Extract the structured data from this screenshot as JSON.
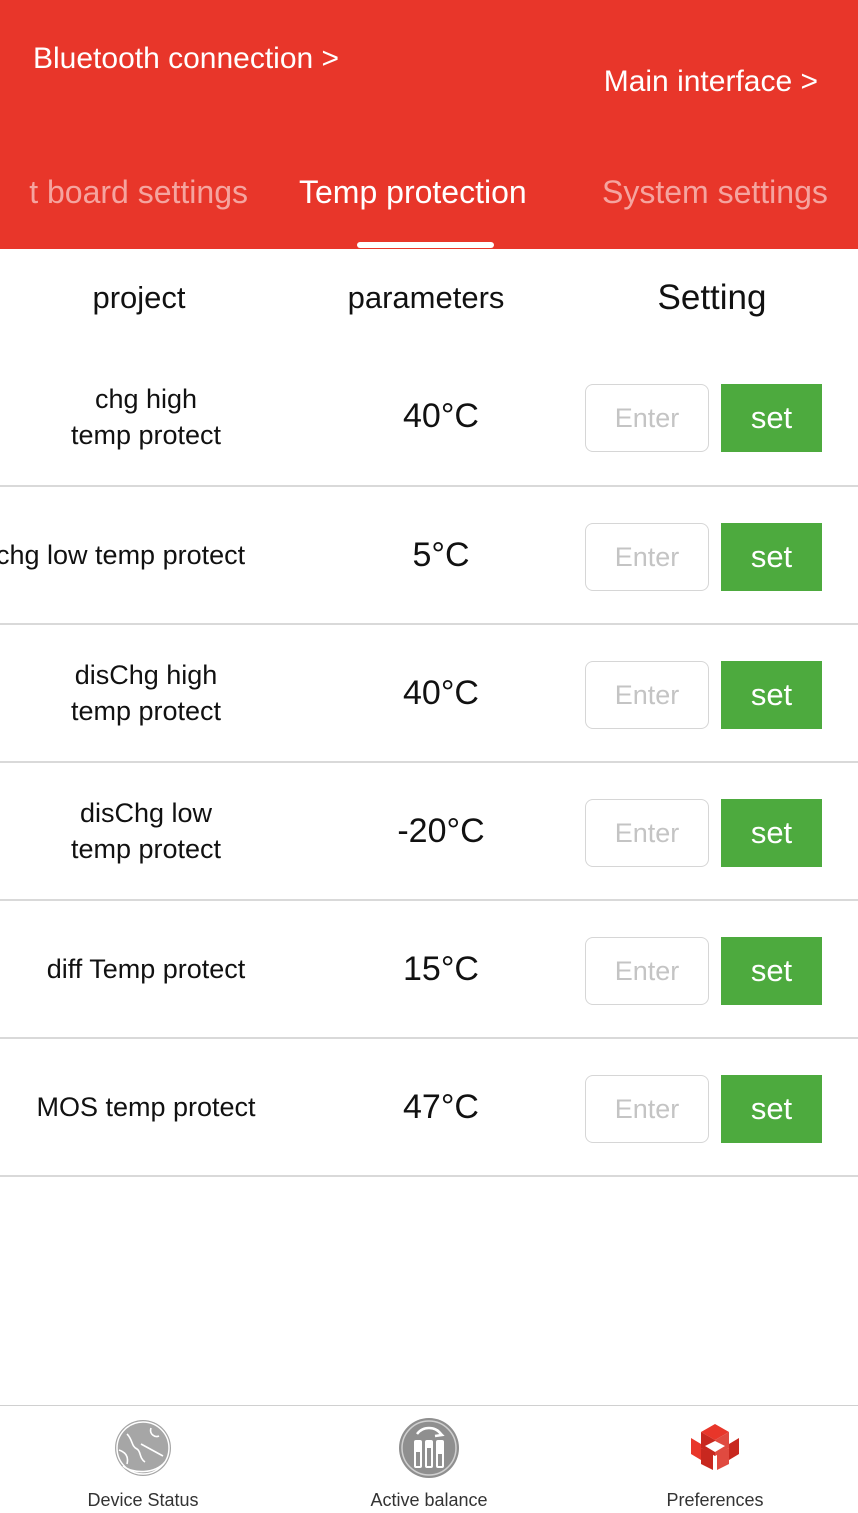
{
  "header": {
    "bluetooth_link": "Bluetooth connection >",
    "main_link": "Main interface >",
    "background_color": "#e8362a"
  },
  "tabs": [
    {
      "label": "t board settings",
      "active": false
    },
    {
      "label": "Temp protection",
      "active": true
    },
    {
      "label": "System settings",
      "active": false
    }
  ],
  "table": {
    "headers": {
      "project": "project",
      "parameters": "parameters",
      "setting": "Setting"
    },
    "rows": [
      {
        "name": "chg high\ntemp protect",
        "value": "40°C",
        "placeholder": "Enter",
        "button": "set"
      },
      {
        "name": "chg low temp protect",
        "value": "5°C",
        "placeholder": "Enter",
        "button": "set"
      },
      {
        "name": "disChg high\ntemp protect",
        "value": "40°C",
        "placeholder": "Enter",
        "button": "set"
      },
      {
        "name": "disChg low\ntemp protect",
        "value": "-20°C",
        "placeholder": "Enter",
        "button": "set"
      },
      {
        "name": "diff Temp protect",
        "value": "15°C",
        "placeholder": "Enter",
        "button": "set"
      },
      {
        "name": "MOS temp protect",
        "value": "47°C",
        "placeholder": "Enter",
        "button": "set"
      }
    ],
    "button_color": "#4daa3e"
  },
  "bottom_nav": [
    {
      "label": "Device Status",
      "icon": "globe-icon",
      "active": false
    },
    {
      "label": "Active balance",
      "icon": "battery-balance-icon",
      "active": false
    },
    {
      "label": "Preferences",
      "icon": "cube-icon",
      "active": true
    }
  ]
}
